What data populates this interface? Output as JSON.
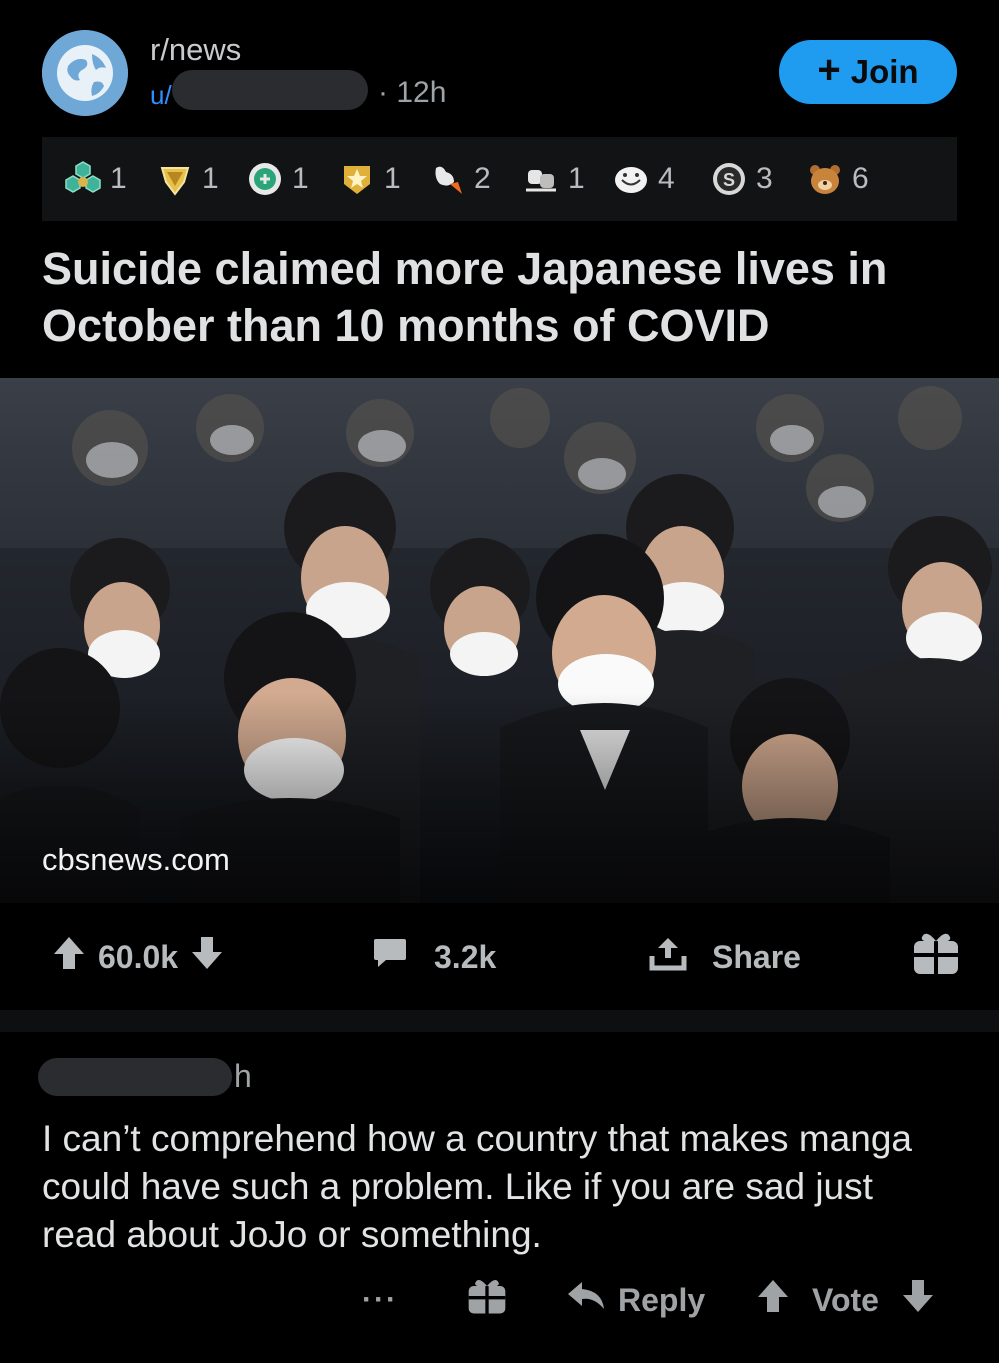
{
  "header": {
    "subreddit": "r/news",
    "user_prefix": "u/",
    "time": "· 12h",
    "join_label": "Join"
  },
  "awards": [
    {
      "icon": "hexagon-gem-award-icon",
      "count": "1"
    },
    {
      "icon": "gold-gem-award-icon",
      "count": "1"
    },
    {
      "icon": "green-medal-award-icon",
      "count": "1"
    },
    {
      "icon": "star-award-icon",
      "count": "1"
    },
    {
      "icon": "rocket-like-award-icon",
      "count": "2"
    },
    {
      "icon": "fist-bump-award-icon",
      "count": "1"
    },
    {
      "icon": "laughing-face-award-icon",
      "count": "4"
    },
    {
      "icon": "silver-coin-award-icon",
      "count": "3"
    },
    {
      "icon": "bear-award-icon",
      "count": "6"
    }
  ],
  "post": {
    "title": "Suicide claimed more Japanese lives in October than 10 months of COVID",
    "domain": "cbsnews.com",
    "votes": "60.0k",
    "comments": "3.2k",
    "share_label": "Share"
  },
  "comment": {
    "time": "h",
    "body": "I can’t comprehend how a country that makes manga could have such a problem. Like if you are sad just read about JoJo or something.",
    "more": "···",
    "reply_label": "Reply",
    "vote_label": "Vote"
  },
  "colors": {
    "background": "#000000",
    "join_button": "#1f9bf0",
    "user_link": "#2f8fff",
    "award_bar": "#121314"
  }
}
